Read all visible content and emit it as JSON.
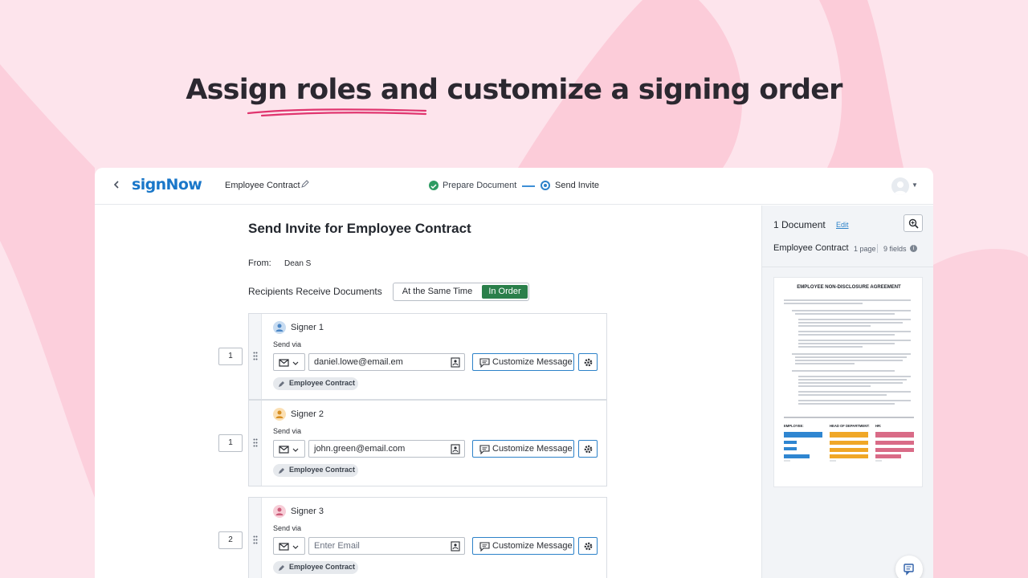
{
  "headline": {
    "part1": "Assign roles",
    "part2": " and customize a signing order"
  },
  "topbar": {
    "logo": "signNow",
    "doc_title": "Employee Contract",
    "step1": "Prepare Document",
    "step2": "Send Invite"
  },
  "main": {
    "title": "Send Invite for Employee Contract",
    "from_label": "From:",
    "from_value": "Dean S",
    "recipients_label": "Recipients Receive Documents",
    "toggle": {
      "option1": "At the Same Time",
      "option2": "In Order",
      "selected": "In Order"
    }
  },
  "signers": [
    {
      "order": "1",
      "name": "Signer 1",
      "send_via": "Send via",
      "email": "daniel.lowe@email.em",
      "customize": "Customize Message",
      "document": "Employee Contract",
      "color": "#7aa6d6"
    },
    {
      "order": "1",
      "name": "Signer 2",
      "send_via": "Send via",
      "email": "john.green@email.com",
      "customize": "Customize Message",
      "document": "Employee Contract",
      "color": "#f2b866"
    },
    {
      "order": "2",
      "name": "Signer 3",
      "send_via": "Send via",
      "email": "",
      "email_placeholder": "Enter Email",
      "customize": "Customize Message",
      "document": "Employee Contract",
      "color": "#e99aac"
    }
  ],
  "sidebar": {
    "count": "1 Document",
    "edit": "Edit",
    "doc_name": "Employee Contract",
    "pages": "1 page",
    "fields": "9 fields",
    "thumb_title": "EMPLOYEE NON-DISCLOSURE AGREEMENT",
    "roles": [
      "EMPLOYEE:",
      "HEAD OF DEPARTMENT:",
      "HR:"
    ],
    "role_colors": [
      "#2f86d1",
      "#f0a727",
      "#d96b87"
    ]
  },
  "colors": {
    "brand": "#1a77c9",
    "accent_green": "#2a7f4a",
    "bg_pink": "#fde4ec"
  }
}
